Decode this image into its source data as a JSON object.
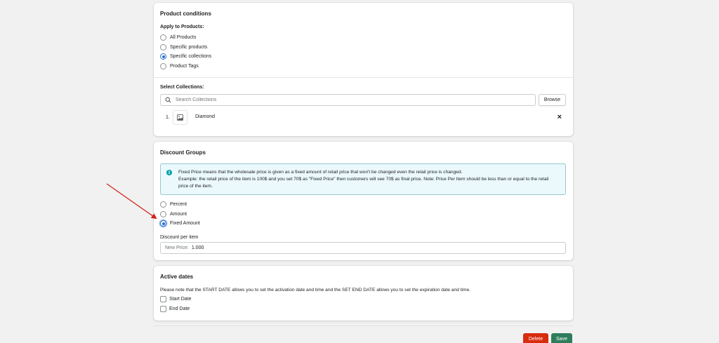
{
  "product_conditions": {
    "title": "Product conditions",
    "apply_label": "Apply to Products:",
    "options": [
      {
        "label": "All Products",
        "checked": false
      },
      {
        "label": "Specific products",
        "checked": false
      },
      {
        "label": "Specific collections",
        "checked": true
      },
      {
        "label": "Product Tags",
        "checked": false
      }
    ],
    "select_label": "Select Collections:",
    "search_placeholder": "Search Collections",
    "browse_label": "Browse",
    "collections": [
      {
        "index": "1.",
        "name": "Diamond",
        "icon": "image-placeholder-icon",
        "remove": "×"
      }
    ]
  },
  "discount_groups": {
    "title": "Discount Groups",
    "info_icon": "info-icon",
    "info_line1": "Fixed Price means that the wholesale price is given as a fixed amount of retail price that won't be changed even the retail price is changed.",
    "info_line2": "Example: the retail price of the item is 100$ and you set 70$ as \"Fixed Price\" then customers will see 70$ as final price. Note: Price Per Item should be less than or equal to the retail price of the item.",
    "options": [
      {
        "label": "Percent",
        "checked": false
      },
      {
        "label": "Amount",
        "checked": false
      },
      {
        "label": "Fixed Amount",
        "checked": true
      }
    ],
    "discount_label": "Discount per item",
    "new_price_prefix": "New Price:",
    "new_price_value": "1.000"
  },
  "active_dates": {
    "title": "Active dates",
    "note": "Please note that the START DATE allows you to set the activation date and time and the SET END DATE allows you to set the expiration date and time.",
    "start_date_label": "Start Date",
    "end_date_label": "End Date"
  },
  "footer": {
    "delete_label": "Delete",
    "save_label": "Save"
  },
  "colors": {
    "accent": "#2c6ecb",
    "delete": "#d82c0d",
    "save": "#2e7d5b",
    "arrow": "#d0231c"
  }
}
